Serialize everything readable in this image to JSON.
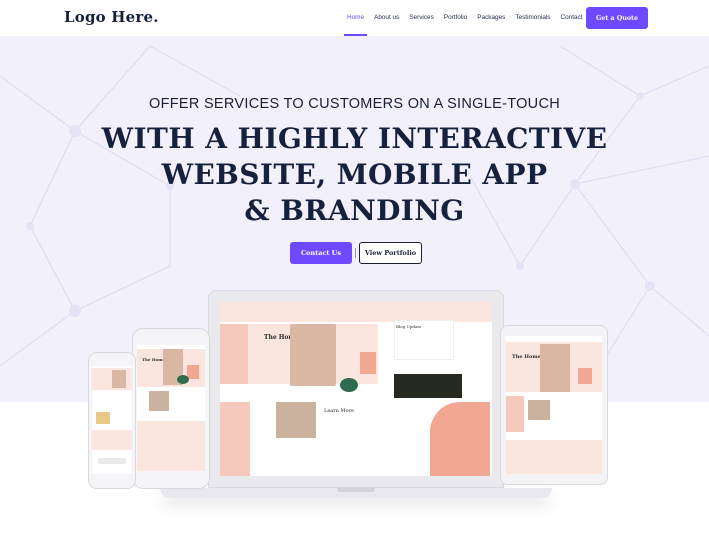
{
  "header": {
    "logo": "Logo Here.",
    "nav": [
      {
        "label": "Home",
        "active": true
      },
      {
        "label": "About us",
        "active": false
      },
      {
        "label": "Services",
        "active": false
      },
      {
        "label": "Portfolio",
        "active": false
      },
      {
        "label": "Packages",
        "active": false
      },
      {
        "label": "Testimonials",
        "active": false
      },
      {
        "label": "Contact",
        "active": false
      }
    ],
    "cta": "Get a Quote"
  },
  "hero": {
    "subtitle": "OFFER SERVICES TO CUSTOMERS ON A SINGLE-TOUCH",
    "title_line1": "WITH A HIGHLY INTERACTIVE",
    "title_line2": "WEBSITE, MOBILE APP",
    "title_line3": "& BRANDING",
    "primary_button": "Contact Us",
    "secondary_button": "View Portfolio"
  },
  "mockup": {
    "laptop_heading": "The Home Of Care",
    "laptop_learn": "Learn More",
    "laptop_blog": "Blog Update",
    "tablet_heading": "The Home Of Care",
    "phone_heading": "The Home Of Care"
  },
  "colors": {
    "accent": "#6d4aff",
    "heading": "#16213d",
    "hero_bg": "#f1f0fb",
    "peach": "#f7c9bd"
  }
}
